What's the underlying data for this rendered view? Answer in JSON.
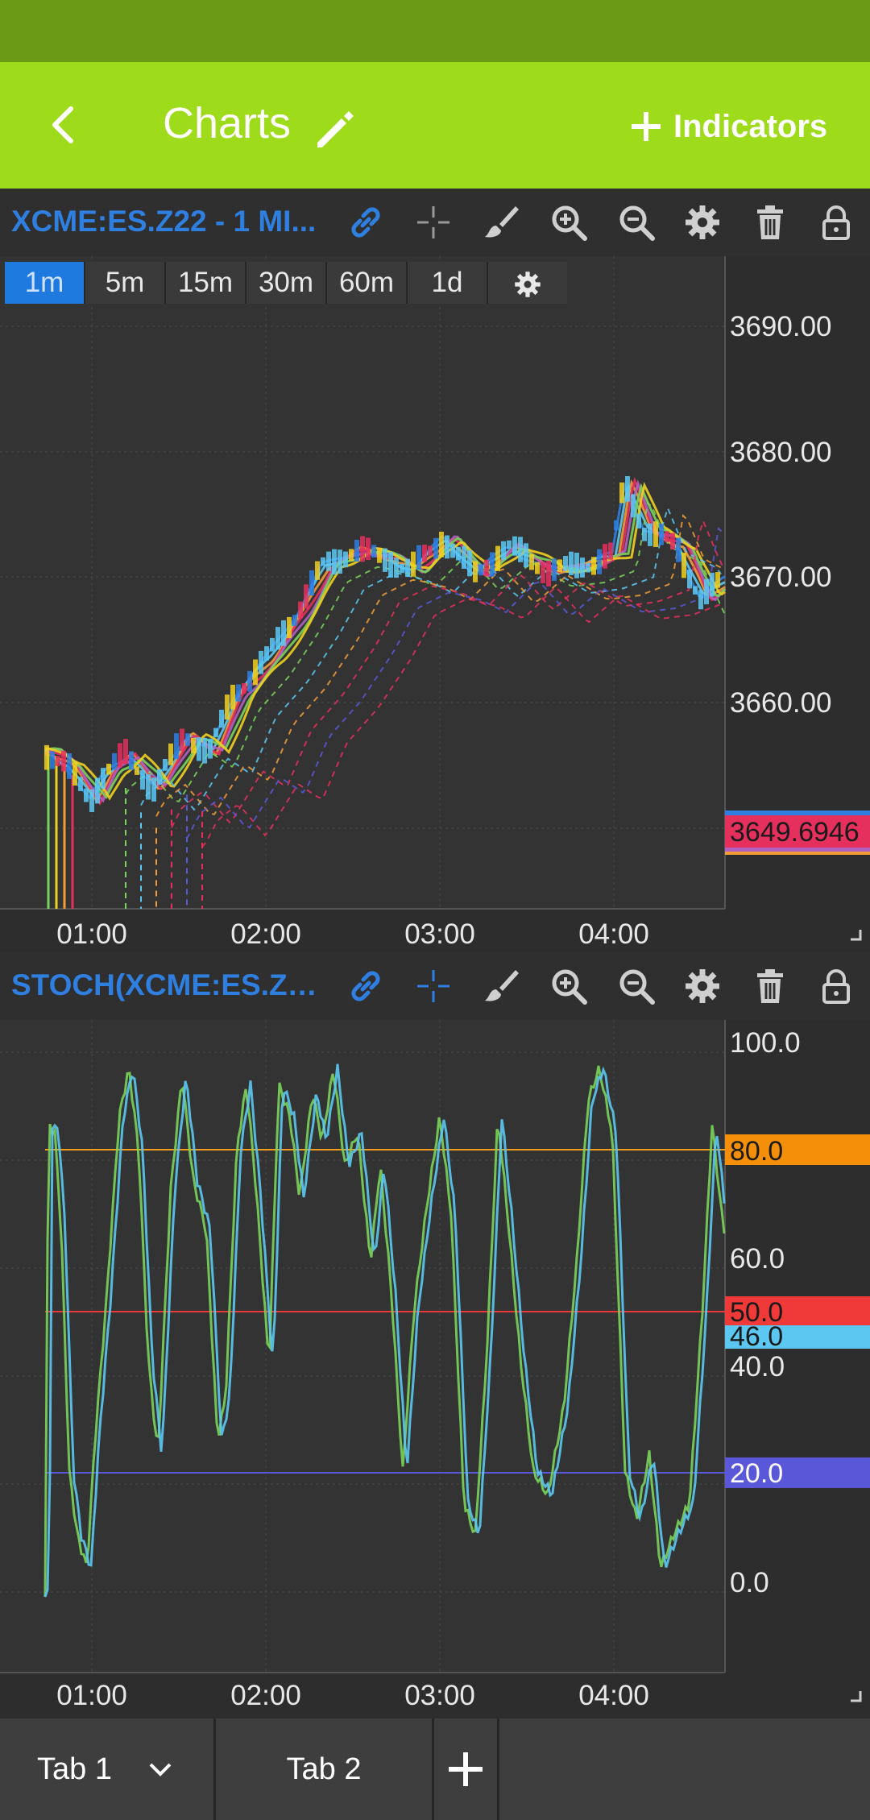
{
  "app": {
    "title": "Charts",
    "back_icon": "back-arrow-icon",
    "edit_icon": "pencil-icon",
    "indicators_label": "Indicators",
    "accent_color": "#9ddb1b"
  },
  "main_chart": {
    "name": "XCME:ES.Z22 - 1 MI...",
    "timeframes": [
      "1m",
      "5m",
      "15m",
      "30m",
      "60m",
      "1d"
    ],
    "active_timeframe": "1m",
    "price_labels": [
      "3690.00",
      "3680.00",
      "3670.00",
      "3660.00"
    ],
    "last_price": "3649.6946",
    "time_labels": [
      "01:00",
      "02:00",
      "03:00",
      "04:00"
    ]
  },
  "stoch_chart": {
    "name": "STOCH(XCME:ES.Z2...",
    "value_labels": [
      "100.0",
      "60.0",
      "40.0",
      "0.0"
    ],
    "level_labels": [
      "80.0",
      "50.0",
      "46.0",
      "20.0"
    ],
    "time_labels": [
      "01:00",
      "02:00",
      "03:00",
      "04:00"
    ]
  },
  "tabs": {
    "tab1": "Tab 1",
    "tab2": "Tab 2"
  }
}
